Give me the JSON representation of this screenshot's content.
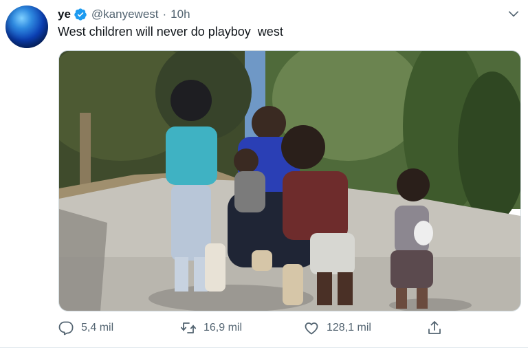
{
  "tweet": {
    "name": "ye",
    "handle": "@kanyewest",
    "separator": "·",
    "time": "10h",
    "text": "West children will never do playboy  west",
    "verified": true
  },
  "actions": {
    "reply_count": "5,4 mil",
    "retweet_count": "16,9 mil",
    "like_count": "128,1 mil"
  },
  "icons": {
    "reply": "reply-icon",
    "retweet": "retweet-icon",
    "like": "heart-icon",
    "share": "share-icon",
    "more": "chevron-down-icon",
    "verified": "verified-badge-icon"
  },
  "colors": {
    "accent": "#1d9bf0",
    "text": "#0f1419",
    "secondary": "#536471"
  }
}
